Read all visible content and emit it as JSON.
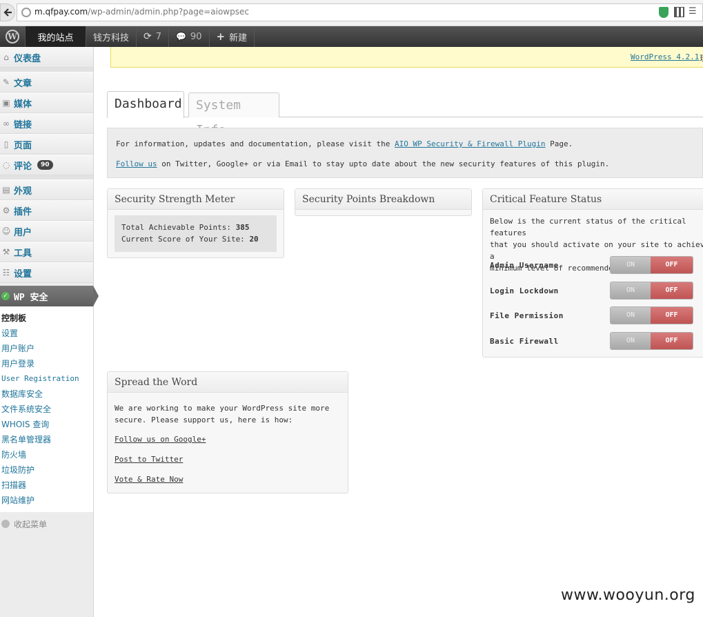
{
  "browser": {
    "url_domain": "m.qfpay.com",
    "url_path": "/wp-admin/admin.php?page=aiowpsec"
  },
  "adminbar": {
    "my_sites": "我的站点",
    "site_name": "钱方科技",
    "updates_count": "7",
    "comments_count": "90",
    "new_label": "新建"
  },
  "sidebar": {
    "items": [
      {
        "label": "仪表盘",
        "icon": "dashboard-icon"
      },
      {
        "label": "文章",
        "icon": "pin-icon"
      },
      {
        "label": "媒体",
        "icon": "media-icon"
      },
      {
        "label": "链接",
        "icon": "link-icon"
      },
      {
        "label": "页面",
        "icon": "page-icon"
      },
      {
        "label": "评论",
        "icon": "comment-icon",
        "badge": "90"
      },
      {
        "label": "外观",
        "icon": "appearance-icon"
      },
      {
        "label": "插件",
        "icon": "plugin-icon"
      },
      {
        "label": "用户",
        "icon": "users-icon"
      },
      {
        "label": "工具",
        "icon": "tools-icon"
      },
      {
        "label": "设置",
        "icon": "settings-icon"
      }
    ],
    "active_label": "WP 安全",
    "submenu": [
      "控制板",
      "设置",
      "用户账户",
      "用户登录",
      "User Registration",
      "数据库安全",
      "文件系统安全",
      "WHOIS 查询",
      "黑名单管理器",
      "防火墙",
      "垃圾防护",
      "扫描器",
      "网站维护"
    ],
    "collapse_label": "收起菜单"
  },
  "notice": {
    "link": "WordPress 4.2.1",
    "tail": "现"
  },
  "tabs": {
    "active": "Dashboard",
    "inactive": "System Info"
  },
  "info": {
    "line1_pre": "For information, updates and documentation, please visit the",
    "line1_link": "AIO WP Security & Firewall Plugin",
    "line1_post": "Page.",
    "line2_link": "Follow us",
    "line2_post": "on Twitter, Google+ or via Email to stay upto date about the new security features of this plugin."
  },
  "strength_meter": {
    "title": "Security Strength Meter",
    "total_label": "Total Achievable Points:",
    "total_value": "385",
    "score_label": "Current Score of Your Site:",
    "score_value": "20"
  },
  "points_breakdown": {
    "title": "Security Points Breakdown"
  },
  "critical": {
    "title": "Critical Feature Status",
    "desc_lines": [
      "Below is the current status of the critical features",
      "that you should activate on your site to achieve a",
      "minimum level of recommended security"
    ],
    "on_label": "ON",
    "off_label": "OFF",
    "features": [
      "Admin Username",
      "Login Lockdown",
      "File Permission",
      "Basic Firewall"
    ]
  },
  "spread": {
    "title": "Spread the Word",
    "text_lines": [
      "We are working to make your WordPress site more",
      "secure. Please support us, here is how:"
    ],
    "links": [
      "Follow us on Google+",
      "Post to Twitter",
      "Vote & Rate Now"
    ]
  },
  "watermark": "www.wooyun.org"
}
